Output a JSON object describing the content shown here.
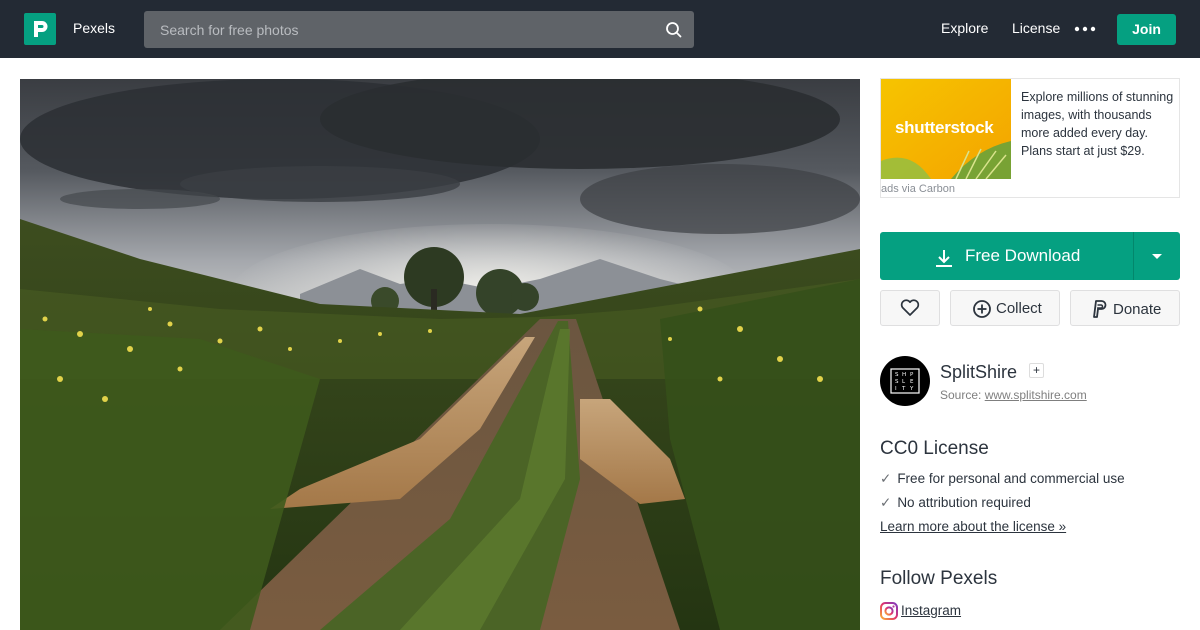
{
  "header": {
    "brand": "Pexels",
    "search_placeholder": "Search for free photos",
    "nav": {
      "explore": "Explore",
      "license": "License"
    },
    "join_label": "Join"
  },
  "ad": {
    "brand_text": "shutterstock",
    "text": "Explore millions of stunning images, with thousands more added every day. Plans start at just $29.",
    "via": "ads via Carbon"
  },
  "download": {
    "label": "Free Download"
  },
  "actions": {
    "collect": "Collect",
    "donate": "Donate"
  },
  "photographer": {
    "name": "SplitShire",
    "follow": "+",
    "source_prefix": "Source:",
    "source_link": "www.splitshire.com"
  },
  "license": {
    "title": "CC0 License",
    "items": [
      "Free for personal and commercial use",
      "No attribution required"
    ],
    "learn_more": "Learn more about the license »"
  },
  "follow": {
    "title": "Follow Pexels",
    "instagram": "Instagram"
  },
  "colors": {
    "brand_green": "#05a081",
    "header_bg": "#232a34",
    "search_bg": "#5f6368"
  }
}
